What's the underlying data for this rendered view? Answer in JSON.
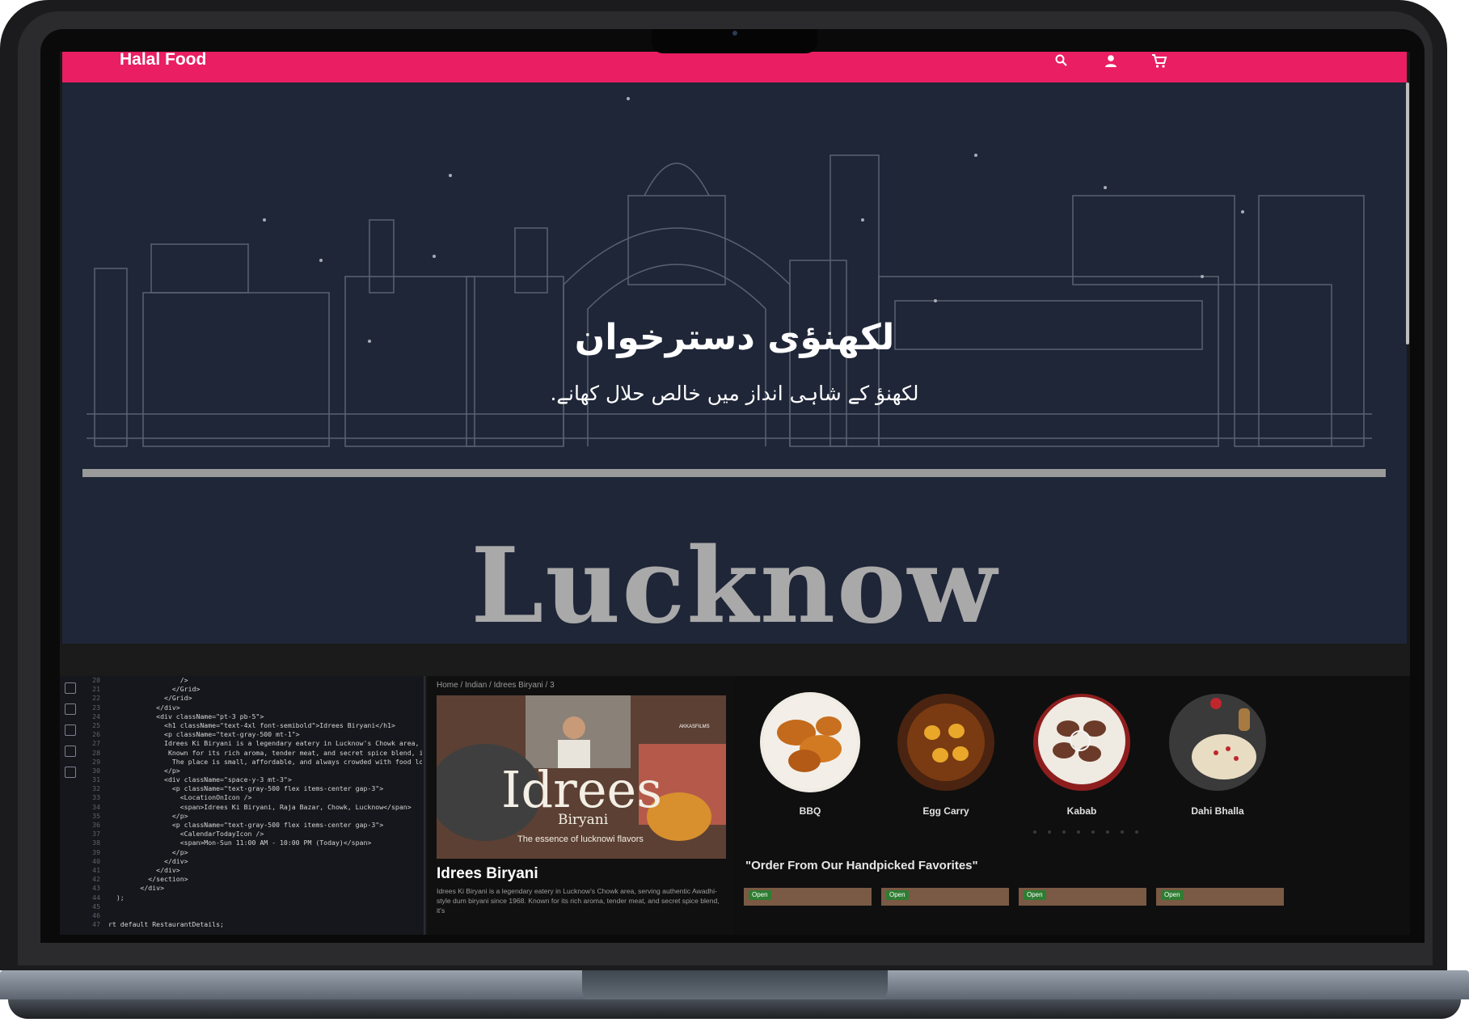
{
  "app": {
    "brand": "Halal Food",
    "accent_color": "#e91e63",
    "nav_icons": [
      "search-icon",
      "account-icon",
      "cart-icon"
    ]
  },
  "hero": {
    "title": "لکھنؤی دسترخوان",
    "subtitle": "لکھنؤ کے شاہی انداز میں خالص حلال کھانے.",
    "city": "Lucknow"
  },
  "code": {
    "lines": [
      {
        "n": "20",
        "t": "                  />"
      },
      {
        "n": "21",
        "t": "                </Grid>"
      },
      {
        "n": "22",
        "t": "              </Grid>"
      },
      {
        "n": "23",
        "t": "            </div>"
      },
      {
        "n": "24",
        "t": "            <div className=\"pt-3 pb-5\">"
      },
      {
        "n": "25",
        "t": "              <h1 className=\"text-4xl font-semibold\">Idrees Biryani</h1>"
      },
      {
        "n": "26",
        "t": "              <p className=\"text-gray-500 mt-1\">"
      },
      {
        "n": "27",
        "t": "              Idrees Ki Biryani is a legendary eatery in Lucknow's Chowk area, serv"
      },
      {
        "n": "28",
        "t": "               Known for its rich aroma, tender meat, and secret spice blend, it's"
      },
      {
        "n": "29",
        "t": "                The place is small, affordable, and always crowded with food lovers"
      },
      {
        "n": "30",
        "t": "              </p>"
      },
      {
        "n": "31",
        "t": "              <div className=\"space-y-3 mt-3\">"
      },
      {
        "n": "32",
        "t": "                <p className=\"text-gray-500 flex items-center gap-3\">"
      },
      {
        "n": "33",
        "t": "                  <LocationOnIcon />"
      },
      {
        "n": "34",
        "t": "                  <span>Idrees Ki Biryani, Raja Bazar, Chowk, Lucknow</span>"
      },
      {
        "n": "35",
        "t": "                </p>"
      },
      {
        "n": "36",
        "t": "                <p className=\"text-gray-500 flex items-center gap-3\">"
      },
      {
        "n": "37",
        "t": "                  <CalendarTodayIcon />"
      },
      {
        "n": "38",
        "t": "                  <span>Mon-Sun 11:00 AM - 10:00 PM (Today)</span>"
      },
      {
        "n": "39",
        "t": "                </p>"
      },
      {
        "n": "40",
        "t": "              </div>"
      },
      {
        "n": "41",
        "t": "            </div>"
      },
      {
        "n": "42",
        "t": "          </section>"
      },
      {
        "n": "43",
        "t": "        </div>"
      },
      {
        "n": "44",
        "t": "  );"
      },
      {
        "n": "45",
        "t": ""
      },
      {
        "n": "46",
        "t": ""
      },
      {
        "n": "47",
        "t": "rt default RestaurantDetails;"
      }
    ]
  },
  "detail": {
    "breadcrumb": "Home / Indian / Idrees Biryani / 3",
    "image_title": "Idrees",
    "image_subtitle": "Biryani",
    "image_tagline": "The essence of lucknowi flavors",
    "image_watermark": "AKKASFILMS",
    "name": "Idrees Biryani",
    "description": "Idrees Ki Biryani is a legendary eatery in Lucknow's Chowk area, serving authentic Awadhi-style dum biryani since 1968. Known for its rich aroma, tender meat, and secret spice blend, it's"
  },
  "categories": [
    {
      "label": "BBQ",
      "color": "#c47a2c"
    },
    {
      "label": "Egg Carry",
      "color": "#7a3b12"
    },
    {
      "label": "Kabab",
      "color": "#6b3a28"
    },
    {
      "label": "Dahi Bhalla",
      "color": "#d8c9a8"
    }
  ],
  "favorites": {
    "title": "\"Order From Our Handpicked Favorites\"",
    "cards": [
      {
        "status": "Open"
      },
      {
        "status": "Open"
      },
      {
        "status": "Open"
      },
      {
        "status": "Open"
      }
    ]
  }
}
